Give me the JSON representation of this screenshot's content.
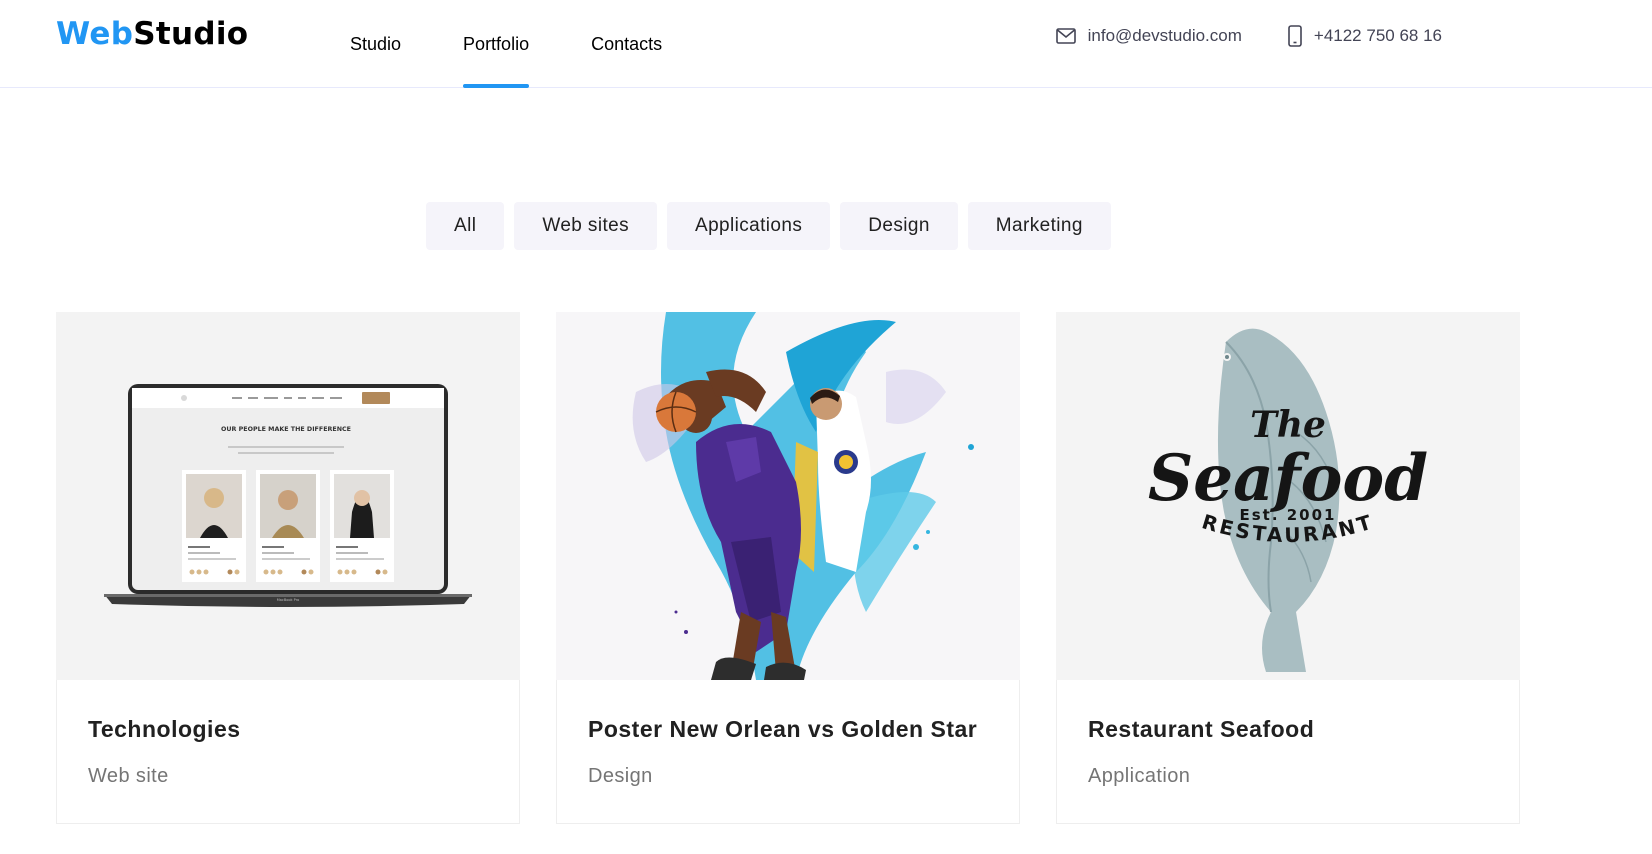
{
  "header": {
    "logo": {
      "part1": "Web",
      "part2": "Studio"
    },
    "nav": [
      {
        "label": "Studio",
        "active": false
      },
      {
        "label": "Portfolio",
        "active": true
      },
      {
        "label": "Contacts",
        "active": false
      }
    ],
    "email": "info@devstudio.com",
    "phone": "+4122 750 68 16",
    "accent_color": "#2196f3"
  },
  "filters": [
    "All",
    "Web sites",
    "Applications",
    "Design",
    "Marketing"
  ],
  "cards": [
    {
      "title": "Technologies",
      "category": "Web site",
      "mockup": {
        "heading": "OUR PEOPLE MAKE THE DIFFERENCE",
        "laptop_label": "MacBook Pro"
      }
    },
    {
      "title": "Poster New Orlean vs Golden Star",
      "category": "Design"
    },
    {
      "title": "Restaurant Seafood",
      "category": "Application",
      "logo": {
        "the": "The",
        "name": "Seafood",
        "est": "Est. 2001",
        "sub": "RESTAURANT"
      }
    }
  ]
}
